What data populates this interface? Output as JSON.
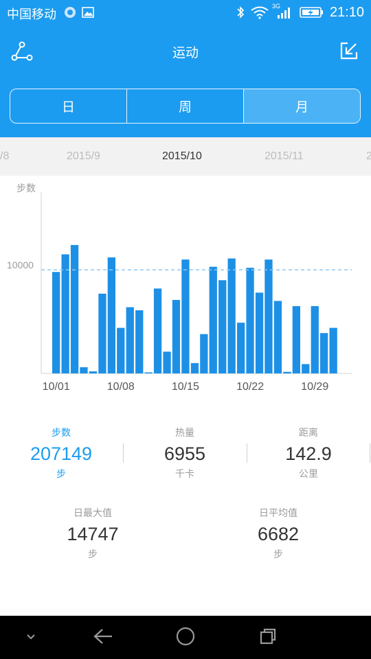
{
  "status_bar": {
    "carrier": "中国移动",
    "network": "3G",
    "time": "21:10"
  },
  "header": {
    "title": "运动",
    "share_icon": "share-icon",
    "export_icon": "export-icon"
  },
  "tabs": [
    {
      "label": "日",
      "active": false
    },
    {
      "label": "周",
      "active": false
    },
    {
      "label": "月",
      "active": true
    }
  ],
  "months": {
    "prev_partial": "/8",
    "prev": "2015/9",
    "current": "2015/10",
    "next": "2015/11",
    "next_partial": "2"
  },
  "colors": {
    "primary": "#1b9cf0",
    "bar": "#1d90e6",
    "muted_text": "#9a9a9a"
  },
  "chart_data": {
    "type": "bar",
    "ylabel": "步数",
    "reference_line": 10000,
    "reference_label": "10000",
    "ymax": 17500,
    "x_tick_labels": [
      "10/01",
      "10/08",
      "10/15",
      "10/22",
      "10/29"
    ],
    "x_tick_days": [
      1,
      8,
      15,
      22,
      29
    ],
    "days": [
      1,
      2,
      3,
      4,
      5,
      6,
      7,
      8,
      9,
      10,
      11,
      12,
      13,
      14,
      15,
      16,
      17,
      18,
      19,
      20,
      21,
      22,
      23,
      24,
      25,
      26,
      27,
      28,
      29,
      30,
      31
    ],
    "values": [
      9800,
      11500,
      12400,
      600,
      200,
      7700,
      11200,
      4400,
      6400,
      6100,
      100,
      8200,
      2100,
      7100,
      11000,
      1000,
      3800,
      10300,
      9000,
      11100,
      4900,
      10200,
      7800,
      11000,
      7000,
      150,
      6500,
      900,
      6500,
      3900,
      4400
    ]
  },
  "stats": {
    "steps": {
      "label": "步数",
      "value": "207149",
      "unit": "步"
    },
    "calories": {
      "label": "热量",
      "value": "6955",
      "unit": "千卡"
    },
    "distance": {
      "label": "距离",
      "value": "142.9",
      "unit": "公里"
    },
    "daily_max": {
      "label": "日最大值",
      "value": "14747",
      "unit": "步"
    },
    "daily_avg": {
      "label": "日平均值",
      "value": "6682",
      "unit": "步"
    }
  }
}
